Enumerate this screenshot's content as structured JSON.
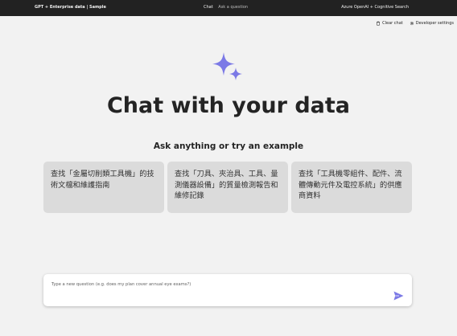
{
  "header": {
    "title": "GPT + Enterprise data | Sample",
    "nav": [
      {
        "label": "Chat"
      },
      {
        "label": "Ask a question"
      }
    ],
    "right_label": "Azure OpenAI + Cognitive Search"
  },
  "commands": {
    "clear_chat": "Clear chat",
    "developer_settings": "Developer settings"
  },
  "main": {
    "title": "Chat with your data",
    "subtitle": "Ask anything or try an example",
    "examples": [
      {
        "text": "查找「金屬切削類工具機」的技術文檔和維護指南"
      },
      {
        "text": "查找「刀具、夾治具、工具、量測儀器設備」的質量檢測報告和維修記錄"
      },
      {
        "text": "查找「工具機零組件、配件、流體傳動元件及電控系統」的供應商資料"
      }
    ]
  },
  "question_input": {
    "placeholder": "Type a new question (e.g. does my plan cover annual eye exams?)",
    "value": ""
  },
  "colors": {
    "header_bg": "#222222",
    "page_bg": "#f2f2f2",
    "example_bg": "#dbdbdb",
    "accent": "#7b79e6"
  },
  "icons": [
    "delete-icon",
    "gear-icon",
    "sparkle-icon",
    "send-icon"
  ]
}
